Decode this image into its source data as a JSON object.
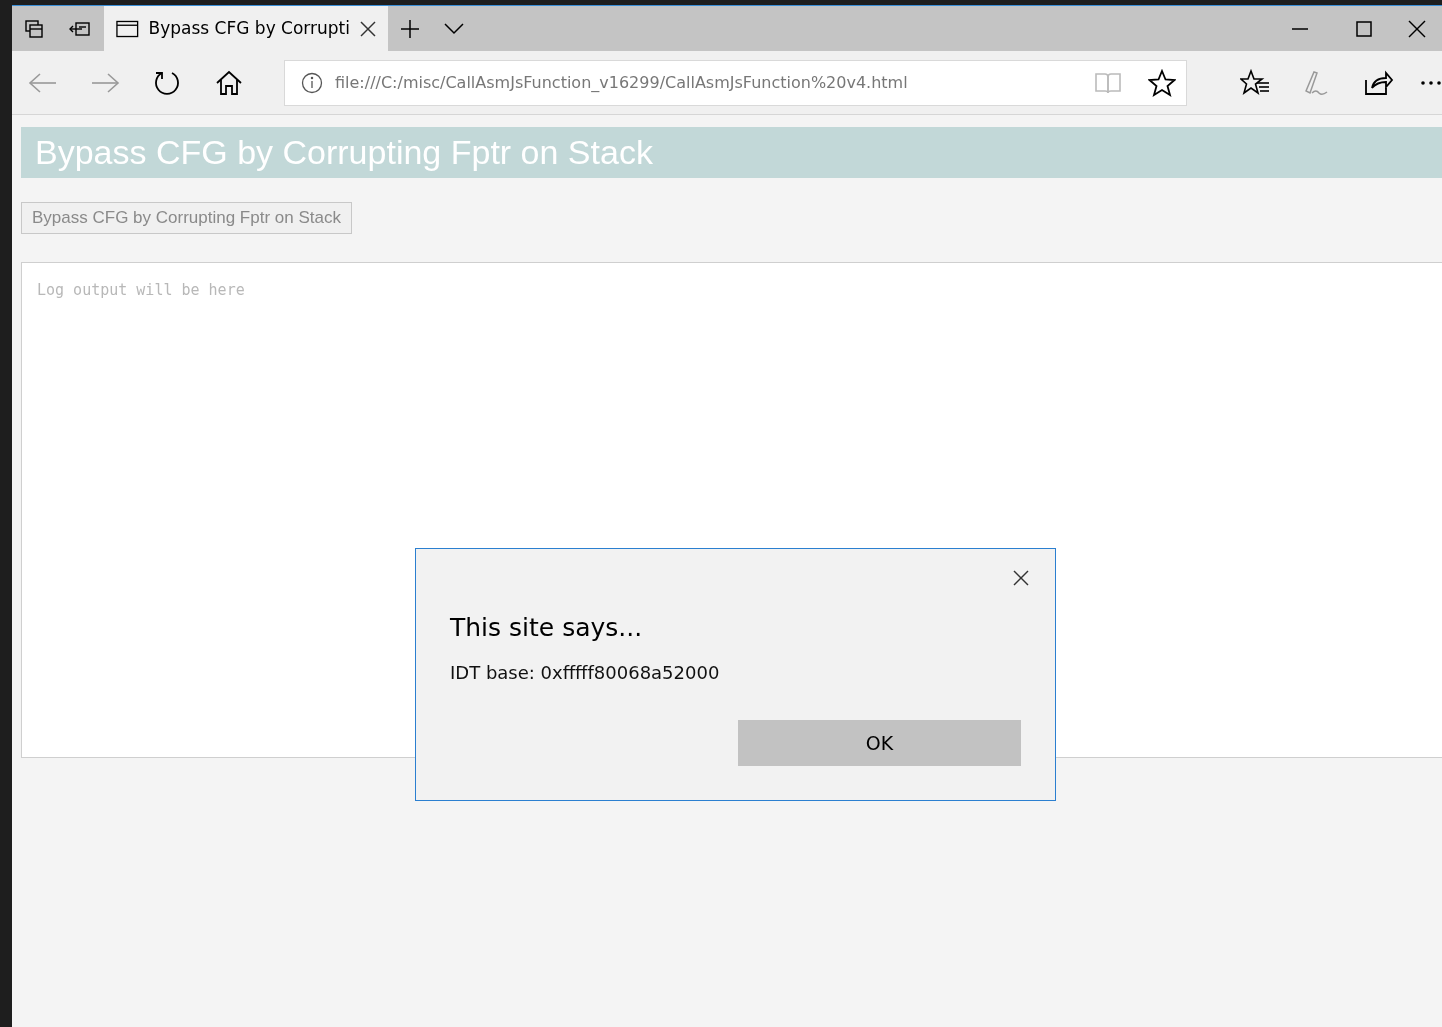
{
  "browser": {
    "tabs": [
      {
        "title": "Bypass CFG by Corrupti",
        "selected": true
      }
    ],
    "address": "file:///C:/misc/CallAsmJsFunction_v16299/CallAsmJsFunction%20v4.html"
  },
  "page": {
    "heading": "Bypass CFG by Corrupting Fptr on Stack",
    "button": "Bypass CFG by Corrupting Fptr on Stack",
    "log": {
      "placeholder": "Log output will be here"
    }
  },
  "dialog": {
    "title": "This site says...",
    "message": "IDT base: 0xfffff80068a52000",
    "button": "OK"
  }
}
